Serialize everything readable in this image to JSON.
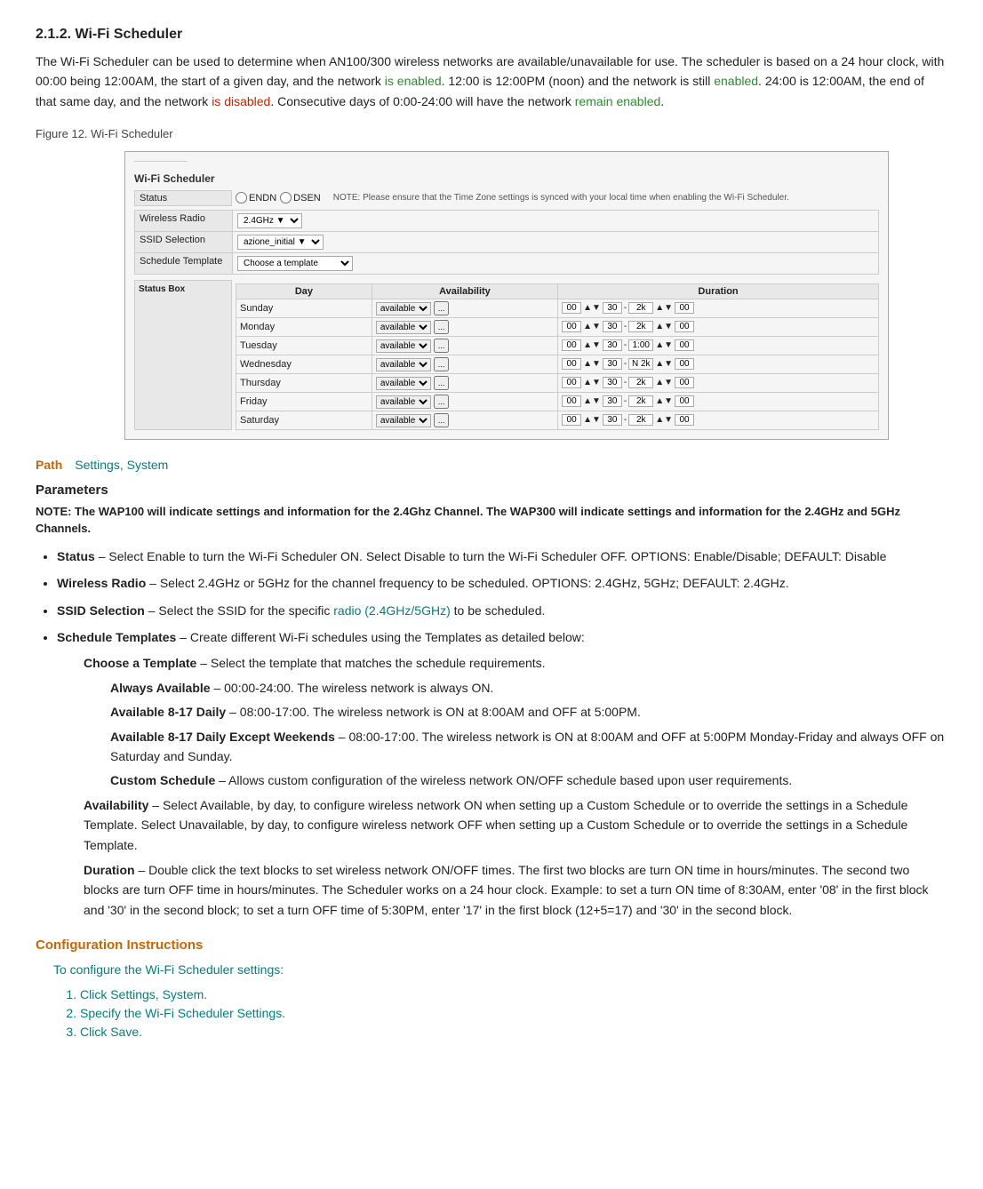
{
  "heading": {
    "title": "2.1.2. Wi-Fi Scheduler",
    "intro_p1_start": "The Wi-Fi Scheduler can be used to determine when AN100/300 wireless networks are available/unavailable for use. The scheduler is based on a 24 hour clock, with 00:00 being 12:00AM, the start of a given day, and the network ",
    "is_enabled": "is enabled",
    "intro_p1_mid": ". 12:00 is 12:00PM (noon) and the network is still ",
    "enabled": "enabled",
    "intro_p1_mid2": ". 24:00 is 12:00AM, the end of that same day, and the network ",
    "is_disabled": "is disabled",
    "intro_p1_end": ". Consecutive days of 0:00-24:00 will have the network ",
    "remain_enabled": "remain enabled",
    "intro_p1_final": "."
  },
  "figure": {
    "label": "Figure 12. Wi-Fi Scheduler"
  },
  "scheduler": {
    "title": "Wi-Fi Scheduler",
    "radio_enable": "ENDN",
    "radio_disable": "DSEN",
    "note": "NOTE: Please ensure that the Time Zone settings is synced with your local time when enabling the Wi-Fi Scheduler.",
    "fields": [
      {
        "label": "Status",
        "value": ""
      },
      {
        "label": "Wireless Radio",
        "value": "2.4GHz"
      },
      {
        "label": "SSID Selection",
        "value": "azione_initial"
      },
      {
        "label": "Schedule Template",
        "value": "Choose a template"
      }
    ],
    "table": {
      "headers": [
        "Day",
        "Availability",
        "Duration"
      ],
      "rows": [
        {
          "day": "Sunday",
          "avail": "available",
          "on_h": "00",
          "on_m": "30",
          "off_h": "2k",
          "off_m": "00"
        },
        {
          "day": "Monday",
          "avail": "available",
          "on_h": "00",
          "on_m": "30",
          "off_h": "2k",
          "off_m": "00"
        },
        {
          "day": "Tuesday",
          "avail": "available",
          "on_h": "00",
          "on_m": "30",
          "off_h": "1:00",
          "off_m": "00"
        },
        {
          "day": "Wednesday",
          "avail": "available",
          "on_h": "00",
          "on_m": "30",
          "off_h": "N 2k",
          "off_m": "00"
        },
        {
          "day": "Thursday",
          "avail": "available",
          "on_h": "00",
          "on_m": "30",
          "off_h": "2k",
          "off_m": "00"
        },
        {
          "day": "Friday",
          "avail": "available",
          "on_h": "00",
          "on_m": "30",
          "off_h": "2k",
          "off_m": "00"
        },
        {
          "day": "Saturday",
          "avail": "available",
          "on_h": "00",
          "on_m": "30",
          "off_h": "2k",
          "off_m": "00"
        }
      ]
    }
  },
  "path": {
    "label": "Path",
    "value": "Settings, System"
  },
  "parameters": {
    "title": "Parameters",
    "note": "NOTE: The WAP100 will indicate settings and information for the 2.4Ghz Channel. The WAP300 will indicate settings and information for the 2.4GHz and 5GHz Channels.",
    "bullets": [
      {
        "term": "Status",
        "desc": " – Select Enable to turn the Wi-Fi Scheduler ON. Select Disable to turn the Wi-Fi Scheduler OFF. OPTIONS: Enable/Disable; DEFAULT: Disable"
      },
      {
        "term": "Wireless Radio",
        "desc": " – Select 2.4GHz or 5GHz for the channel frequency to be scheduled. OPTIONS: 2.4GHz, 5GHz; DEFAULT: 2.4GHz."
      },
      {
        "term": "SSID Selection",
        "desc_start": " – Select the SSID for the specific ",
        "desc_link": "radio (2.4GHz/5GHz)",
        "desc_end": " to be scheduled."
      },
      {
        "term": "Schedule Templates",
        "desc": " – Create different Wi-Fi schedules using the Templates as detailed below:"
      }
    ],
    "sub_items": [
      {
        "term": "Choose a Template",
        "desc": " – Select the template that matches the schedule requirements."
      }
    ],
    "sub_sub_items": [
      {
        "term": "Always Available",
        "desc": " – 00:00-24:00. The wireless network is always ON."
      },
      {
        "term": "Available 8-17 Daily",
        "desc": " – 08:00-17:00. The wireless network is ON at 8:00AM and OFF at 5:00PM."
      },
      {
        "term": "Available 8-17 Daily Except Weekends",
        "desc": " – 08:00-17:00. The wireless network is ON at 8:00AM and OFF at 5:00PM Monday-Friday and always OFF on Saturday and Sunday."
      },
      {
        "term": "Custom Schedule",
        "desc": " – Allows custom configuration of the wireless network ON/OFF schedule based upon user requirements."
      }
    ],
    "availability_item": {
      "term": "Availability",
      "desc": " – Select Available, by day, to configure wireless network ON when setting up a Custom Schedule or to override the settings in a Schedule Template. Select Unavailable, by day, to configure wireless network OFF when setting up a Custom Schedule or to override the settings in a Schedule Template."
    },
    "duration_item": {
      "term": "Duration",
      "desc": " – Double click the text blocks to set wireless network ON/OFF times. The first two blocks are turn ON time in hours/minutes. The second two blocks are turn OFF time in hours/minutes. The Scheduler works on a 24 hour clock. Example: to set a turn ON time of 8:30AM, enter '08' in the first block and '30' in the second block; to set a turn OFF time of 5:30PM, enter '17' in the first block (12+5=17) and '30' in the second block."
    }
  },
  "config": {
    "title": "Configuration Instructions",
    "intro": "To configure the Wi-Fi Scheduler settings:",
    "steps": [
      "Click Settings, System.",
      "Specify the Wi-Fi Scheduler Settings.",
      "Click Save."
    ]
  }
}
